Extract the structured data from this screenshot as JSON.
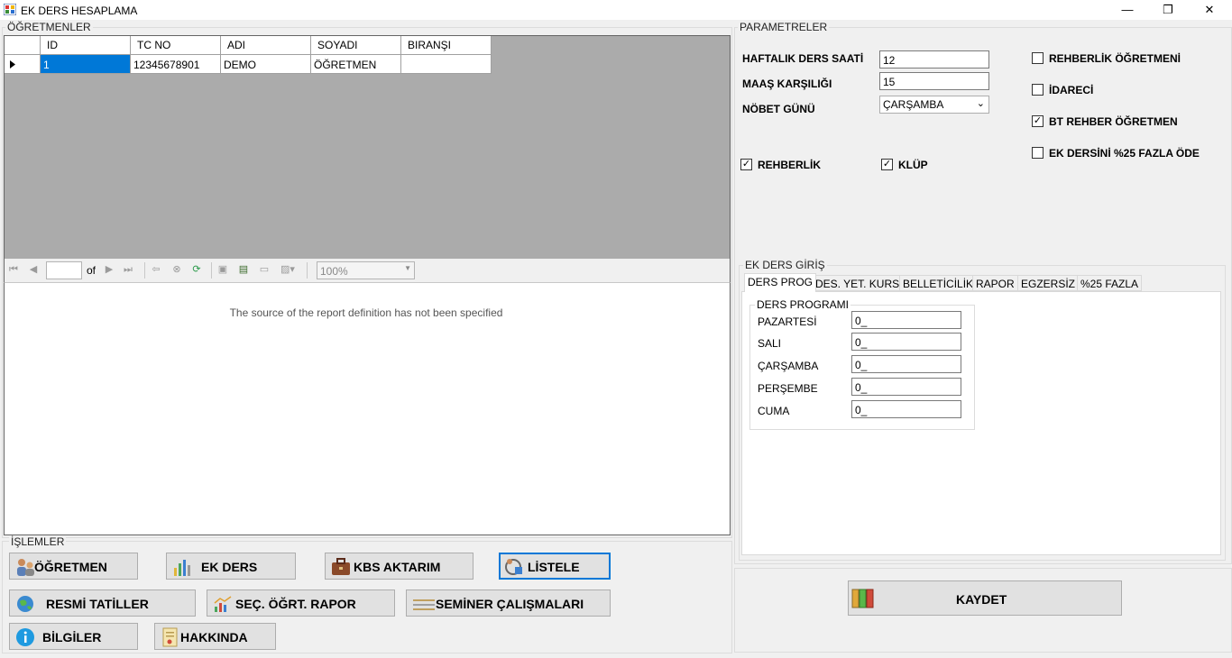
{
  "window": {
    "title": "EK DERS HESAPLAMA",
    "min_glyph": "—",
    "max_glyph": "❐",
    "close_glyph": "✕"
  },
  "teachers": {
    "group_title": "ÖĞRETMENLER",
    "columns": [
      "ID",
      "TC NO",
      "ADI",
      "SOYADI",
      "BIRANŞI"
    ],
    "rows": [
      [
        "1",
        "12345678901",
        "DEMO",
        "ÖĞRETMEN",
        ""
      ]
    ]
  },
  "report": {
    "page_of": "of",
    "zoom": "100%",
    "message": "The source of the report definition has not been specified"
  },
  "operations": {
    "group_title": "İŞLEMLER",
    "buttons": {
      "ogretmen": "ÖĞRETMEN",
      "ek_ders": "EK DERS",
      "kbs": "KBS AKTARIM",
      "listele": "LİSTELE",
      "resmi": "RESMİ TATİLLER",
      "sec_rapor": "SEÇ. ÖĞRT. RAPOR",
      "seminer": "SEMİNER ÇALIŞMALARI",
      "bilgiler": "BİLGİLER",
      "hakkinda": "HAKKINDA"
    }
  },
  "parameters": {
    "group_title": "PARAMETRELER",
    "weekly_hours_label": "HAFTALIK DERS SAATİ",
    "weekly_hours_value": "12",
    "salary_label": "MAAŞ KARŞILIĞI",
    "salary_value": "15",
    "duty_day_label": "NÖBET GÜNÜ",
    "duty_day_value": "ÇARŞAMBA",
    "checks": {
      "rehberlik_ogretmeni": {
        "label": "REHBERLİK ÖĞRETMENİ",
        "checked": false
      },
      "idareci": {
        "label": "İDARECİ",
        "checked": false
      },
      "bt_rehber": {
        "label": "BT REHBER ÖĞRETMEN",
        "checked": true
      },
      "ek_ders_fazla": {
        "label": "EK DERSİNİ %25 FAZLA ÖDE",
        "checked": false
      },
      "rehberlik": {
        "label": "REHBERLİK",
        "checked": true
      },
      "klup": {
        "label": "KLÜP",
        "checked": true
      }
    }
  },
  "ek_ders_giris": {
    "group_title": "EK DERS GİRİŞ",
    "tabs": [
      "DERS PROG",
      "DES. YET. KURS",
      "BELLETİCİLİK",
      "RAPOR",
      "EGZERSİZ",
      "%25 FAZLA"
    ],
    "active_tab": "DERS PROG",
    "program": {
      "group_title": "DERS PROGRAMI",
      "days": [
        {
          "label": "PAZARTESİ",
          "value": "0_"
        },
        {
          "label": "SALI",
          "value": "0_"
        },
        {
          "label": "ÇARŞAMBA",
          "value": "0_"
        },
        {
          "label": "PERŞEMBE",
          "value": "0_"
        },
        {
          "label": "CUMA",
          "value": "0_"
        }
      ]
    }
  },
  "save_button": "KAYDET"
}
